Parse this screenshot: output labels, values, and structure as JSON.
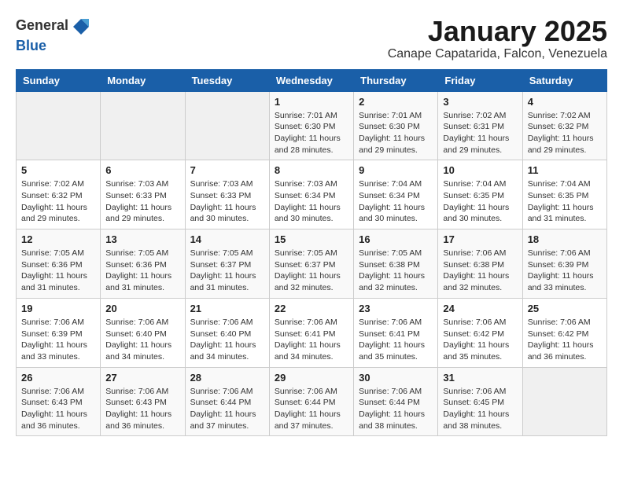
{
  "header": {
    "logo_general": "General",
    "logo_blue": "Blue",
    "month_title": "January 2025",
    "location": "Canape Capatarida, Falcon, Venezuela"
  },
  "weekdays": [
    "Sunday",
    "Monday",
    "Tuesday",
    "Wednesday",
    "Thursday",
    "Friday",
    "Saturday"
  ],
  "weeks": [
    [
      {
        "day": "",
        "sunrise": "",
        "sunset": "",
        "daylight": ""
      },
      {
        "day": "",
        "sunrise": "",
        "sunset": "",
        "daylight": ""
      },
      {
        "day": "",
        "sunrise": "",
        "sunset": "",
        "daylight": ""
      },
      {
        "day": "1",
        "sunrise": "Sunrise: 7:01 AM",
        "sunset": "Sunset: 6:30 PM",
        "daylight": "Daylight: 11 hours and 28 minutes."
      },
      {
        "day": "2",
        "sunrise": "Sunrise: 7:01 AM",
        "sunset": "Sunset: 6:30 PM",
        "daylight": "Daylight: 11 hours and 29 minutes."
      },
      {
        "day": "3",
        "sunrise": "Sunrise: 7:02 AM",
        "sunset": "Sunset: 6:31 PM",
        "daylight": "Daylight: 11 hours and 29 minutes."
      },
      {
        "day": "4",
        "sunrise": "Sunrise: 7:02 AM",
        "sunset": "Sunset: 6:32 PM",
        "daylight": "Daylight: 11 hours and 29 minutes."
      }
    ],
    [
      {
        "day": "5",
        "sunrise": "Sunrise: 7:02 AM",
        "sunset": "Sunset: 6:32 PM",
        "daylight": "Daylight: 11 hours and 29 minutes."
      },
      {
        "day": "6",
        "sunrise": "Sunrise: 7:03 AM",
        "sunset": "Sunset: 6:33 PM",
        "daylight": "Daylight: 11 hours and 29 minutes."
      },
      {
        "day": "7",
        "sunrise": "Sunrise: 7:03 AM",
        "sunset": "Sunset: 6:33 PM",
        "daylight": "Daylight: 11 hours and 30 minutes."
      },
      {
        "day": "8",
        "sunrise": "Sunrise: 7:03 AM",
        "sunset": "Sunset: 6:34 PM",
        "daylight": "Daylight: 11 hours and 30 minutes."
      },
      {
        "day": "9",
        "sunrise": "Sunrise: 7:04 AM",
        "sunset": "Sunset: 6:34 PM",
        "daylight": "Daylight: 11 hours and 30 minutes."
      },
      {
        "day": "10",
        "sunrise": "Sunrise: 7:04 AM",
        "sunset": "Sunset: 6:35 PM",
        "daylight": "Daylight: 11 hours and 30 minutes."
      },
      {
        "day": "11",
        "sunrise": "Sunrise: 7:04 AM",
        "sunset": "Sunset: 6:35 PM",
        "daylight": "Daylight: 11 hours and 31 minutes."
      }
    ],
    [
      {
        "day": "12",
        "sunrise": "Sunrise: 7:05 AM",
        "sunset": "Sunset: 6:36 PM",
        "daylight": "Daylight: 11 hours and 31 minutes."
      },
      {
        "day": "13",
        "sunrise": "Sunrise: 7:05 AM",
        "sunset": "Sunset: 6:36 PM",
        "daylight": "Daylight: 11 hours and 31 minutes."
      },
      {
        "day": "14",
        "sunrise": "Sunrise: 7:05 AM",
        "sunset": "Sunset: 6:37 PM",
        "daylight": "Daylight: 11 hours and 31 minutes."
      },
      {
        "day": "15",
        "sunrise": "Sunrise: 7:05 AM",
        "sunset": "Sunset: 6:37 PM",
        "daylight": "Daylight: 11 hours and 32 minutes."
      },
      {
        "day": "16",
        "sunrise": "Sunrise: 7:05 AM",
        "sunset": "Sunset: 6:38 PM",
        "daylight": "Daylight: 11 hours and 32 minutes."
      },
      {
        "day": "17",
        "sunrise": "Sunrise: 7:06 AM",
        "sunset": "Sunset: 6:38 PM",
        "daylight": "Daylight: 11 hours and 32 minutes."
      },
      {
        "day": "18",
        "sunrise": "Sunrise: 7:06 AM",
        "sunset": "Sunset: 6:39 PM",
        "daylight": "Daylight: 11 hours and 33 minutes."
      }
    ],
    [
      {
        "day": "19",
        "sunrise": "Sunrise: 7:06 AM",
        "sunset": "Sunset: 6:39 PM",
        "daylight": "Daylight: 11 hours and 33 minutes."
      },
      {
        "day": "20",
        "sunrise": "Sunrise: 7:06 AM",
        "sunset": "Sunset: 6:40 PM",
        "daylight": "Daylight: 11 hours and 34 minutes."
      },
      {
        "day": "21",
        "sunrise": "Sunrise: 7:06 AM",
        "sunset": "Sunset: 6:40 PM",
        "daylight": "Daylight: 11 hours and 34 minutes."
      },
      {
        "day": "22",
        "sunrise": "Sunrise: 7:06 AM",
        "sunset": "Sunset: 6:41 PM",
        "daylight": "Daylight: 11 hours and 34 minutes."
      },
      {
        "day": "23",
        "sunrise": "Sunrise: 7:06 AM",
        "sunset": "Sunset: 6:41 PM",
        "daylight": "Daylight: 11 hours and 35 minutes."
      },
      {
        "day": "24",
        "sunrise": "Sunrise: 7:06 AM",
        "sunset": "Sunset: 6:42 PM",
        "daylight": "Daylight: 11 hours and 35 minutes."
      },
      {
        "day": "25",
        "sunrise": "Sunrise: 7:06 AM",
        "sunset": "Sunset: 6:42 PM",
        "daylight": "Daylight: 11 hours and 36 minutes."
      }
    ],
    [
      {
        "day": "26",
        "sunrise": "Sunrise: 7:06 AM",
        "sunset": "Sunset: 6:43 PM",
        "daylight": "Daylight: 11 hours and 36 minutes."
      },
      {
        "day": "27",
        "sunrise": "Sunrise: 7:06 AM",
        "sunset": "Sunset: 6:43 PM",
        "daylight": "Daylight: 11 hours and 36 minutes."
      },
      {
        "day": "28",
        "sunrise": "Sunrise: 7:06 AM",
        "sunset": "Sunset: 6:44 PM",
        "daylight": "Daylight: 11 hours and 37 minutes."
      },
      {
        "day": "29",
        "sunrise": "Sunrise: 7:06 AM",
        "sunset": "Sunset: 6:44 PM",
        "daylight": "Daylight: 11 hours and 37 minutes."
      },
      {
        "day": "30",
        "sunrise": "Sunrise: 7:06 AM",
        "sunset": "Sunset: 6:44 PM",
        "daylight": "Daylight: 11 hours and 38 minutes."
      },
      {
        "day": "31",
        "sunrise": "Sunrise: 7:06 AM",
        "sunset": "Sunset: 6:45 PM",
        "daylight": "Daylight: 11 hours and 38 minutes."
      },
      {
        "day": "",
        "sunrise": "",
        "sunset": "",
        "daylight": ""
      }
    ]
  ]
}
